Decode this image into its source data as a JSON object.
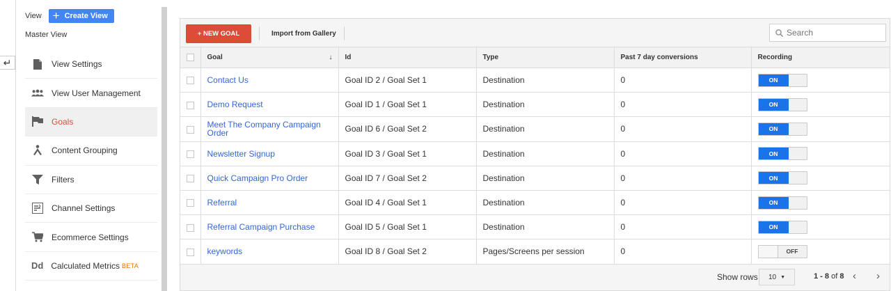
{
  "sidebar": {
    "view_label": "View",
    "create_view_label": "Create View",
    "view_name": "Master View",
    "items": [
      {
        "label": "View Settings",
        "icon": "document-icon"
      },
      {
        "label": "View User Management",
        "icon": "people-icon"
      },
      {
        "label": "Goals",
        "icon": "flag-icon",
        "active": true
      },
      {
        "label": "Content Grouping",
        "icon": "person-walking-icon"
      },
      {
        "label": "Filters",
        "icon": "filter-icon"
      },
      {
        "label": "Channel Settings",
        "icon": "channel-icon"
      },
      {
        "label": "Ecommerce Settings",
        "icon": "cart-icon"
      },
      {
        "label": "Calculated Metrics",
        "icon": "dd-icon",
        "badge": "BETA",
        "icon_text": "Dd"
      }
    ]
  },
  "toolbar": {
    "new_goal_label": "+ NEW GOAL",
    "import_label": "Import from Gallery",
    "search_placeholder": "Search"
  },
  "table": {
    "columns": [
      "Goal",
      "Id",
      "Type",
      "Past 7 day conversions",
      "Recording"
    ],
    "rows": [
      {
        "goal": "Contact Us",
        "id": "Goal ID 2 / Goal Set 1",
        "type": "Destination",
        "conversions": "0",
        "recording": "ON"
      },
      {
        "goal": "Demo Request",
        "id": "Goal ID 1 / Goal Set 1",
        "type": "Destination",
        "conversions": "0",
        "recording": "ON"
      },
      {
        "goal": "Meet The Company Campaign Order",
        "id": "Goal ID 6 / Goal Set 2",
        "type": "Destination",
        "conversions": "0",
        "recording": "ON"
      },
      {
        "goal": "Newsletter Signup",
        "id": "Goal ID 3 / Goal Set 1",
        "type": "Destination",
        "conversions": "0",
        "recording": "ON"
      },
      {
        "goal": "Quick Campaign Pro Order",
        "id": "Goal ID 7 / Goal Set 2",
        "type": "Destination",
        "conversions": "0",
        "recording": "ON"
      },
      {
        "goal": "Referral",
        "id": "Goal ID 4 / Goal Set 1",
        "type": "Destination",
        "conversions": "0",
        "recording": "ON"
      },
      {
        "goal": "Referral Campaign Purchase",
        "id": "Goal ID 5 / Goal Set 1",
        "type": "Destination",
        "conversions": "0",
        "recording": "ON"
      },
      {
        "goal": "keywords",
        "id": "Goal ID 8 / Goal Set 2",
        "type": "Pages/Screens per session",
        "conversions": "0",
        "recording": "OFF"
      }
    ]
  },
  "pager": {
    "show_rows_label": "Show rows",
    "rows_per_page": "10",
    "range": "1 - 8",
    "of_label": "of",
    "total": "8"
  },
  "colors": {
    "new_goal_red": "#dd4b39",
    "create_view_blue": "#4285f4",
    "toggle_on_blue": "#1a73e8",
    "link_blue": "#3367d6"
  }
}
